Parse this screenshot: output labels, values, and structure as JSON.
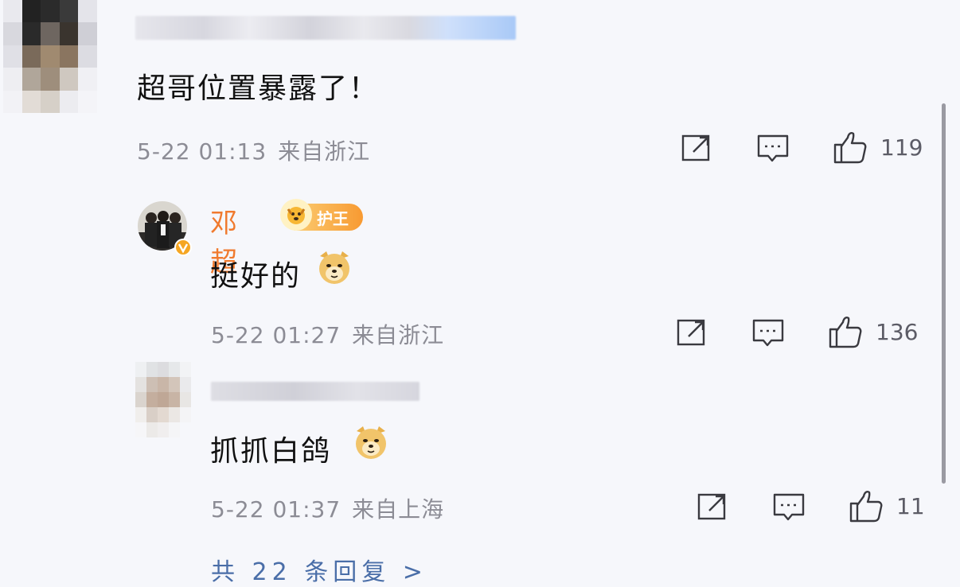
{
  "comments": [
    {
      "text": "超哥位置暴露了！",
      "date": "5-22 01:13",
      "location": "来自浙江",
      "likes": "119"
    },
    {
      "username": "邓超",
      "badge": "护王",
      "text": "挺好的",
      "date": "5-22 01:27",
      "location": "来自浙江",
      "likes": "136"
    },
    {
      "text": "抓抓白鸽",
      "date": "5-22 01:37",
      "location": "来自上海",
      "likes": "11"
    }
  ],
  "footer": {
    "more_replies": "共 22 条回复 >"
  },
  "icons": {
    "share": "share-icon",
    "comment": "comment-icon",
    "like": "thumbs-up-icon",
    "emoji": "doge-emoji-icon"
  },
  "colors": {
    "username": "#f07a2e",
    "meta": "#8c8c95",
    "background": "#f6f7fb"
  }
}
